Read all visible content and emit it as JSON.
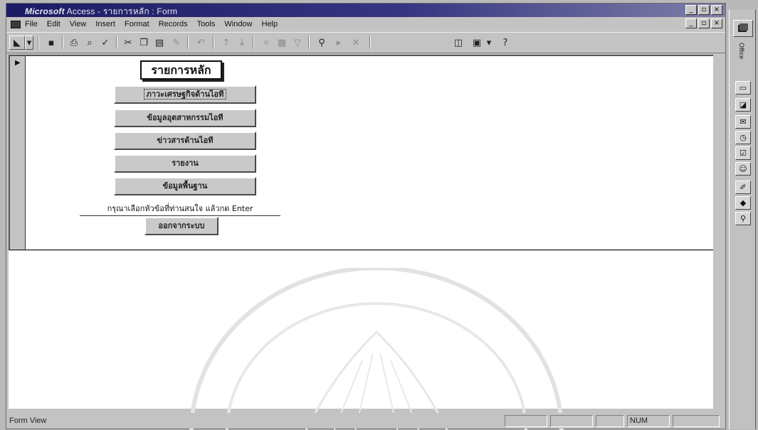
{
  "window": {
    "title_brand": "Microsoft",
    "title_rest": " Access - รายการหลัก : Form"
  },
  "window_controls": {
    "minimize": "_",
    "restore": "▫",
    "close": "×"
  },
  "menubar": {
    "items": [
      "File",
      "Edit",
      "View",
      "Insert",
      "Format",
      "Records",
      "Tools",
      "Window",
      "Help"
    ]
  },
  "toolbar": {
    "buttons": [
      {
        "icon": "view-icon",
        "glyph": "◣"
      },
      {
        "icon": "dropdown-icon",
        "glyph": "▾"
      },
      {
        "icon": "save-icon",
        "glyph": "▪"
      },
      {
        "icon": "print-icon",
        "glyph": "⎙"
      },
      {
        "icon": "print-preview-icon",
        "glyph": "⌕"
      },
      {
        "icon": "spelling-icon",
        "glyph": "✓"
      },
      {
        "icon": "cut-icon",
        "glyph": "✂"
      },
      {
        "icon": "copy-icon",
        "glyph": "❐"
      },
      {
        "icon": "paste-icon",
        "glyph": "▤"
      },
      {
        "icon": "format-painter-icon",
        "glyph": "✎"
      },
      {
        "icon": "undo-icon",
        "glyph": "↶"
      },
      {
        "icon": "sort-ascending-icon",
        "glyph": "↑"
      },
      {
        "icon": "sort-descending-icon",
        "glyph": "↓"
      },
      {
        "icon": "filter-by-selection-icon",
        "glyph": "⌗"
      },
      {
        "icon": "filter-by-form-icon",
        "glyph": "▦"
      },
      {
        "icon": "apply-filter-icon",
        "glyph": "▽"
      },
      {
        "icon": "find-icon",
        "glyph": "⚲"
      },
      {
        "icon": "new-record-icon",
        "glyph": "▸"
      },
      {
        "icon": "delete-record-icon",
        "glyph": "✕"
      },
      {
        "icon": "database-window-icon",
        "glyph": "◫"
      },
      {
        "icon": "new-object-icon",
        "glyph": "▣"
      },
      {
        "icon": "help-icon",
        "glyph": "?"
      }
    ]
  },
  "form": {
    "title": "รายการหลัก",
    "buttons": [
      "ภาวะเศรษฐกิจด้านไอที",
      "ข้อมูลอุตสาหกรรมไอที",
      "ข่าวสารด้านไอที",
      "รายงาน",
      "ข้อมูลพื้นฐาน"
    ],
    "instruction": "กรุณาเลือกหัวข้อที่ท่านสนใจ แล้วกด Enter",
    "exit_button": "ออกจากระบบ"
  },
  "statusbar": {
    "mode": "Form View",
    "num": "NUM"
  },
  "office_bar": {
    "label": "Office"
  }
}
